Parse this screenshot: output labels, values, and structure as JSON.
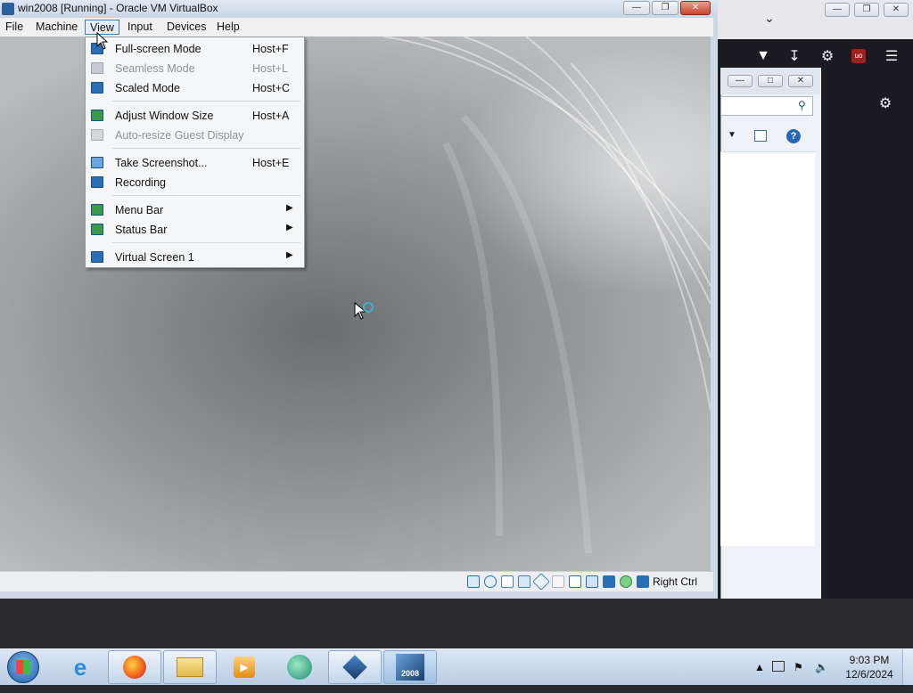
{
  "vbox": {
    "title": "win2008 [Running] - Oracle VM VirtualBox",
    "menubar": [
      "File",
      "Machine",
      "View",
      "Input",
      "Devices",
      "Help"
    ],
    "status_hostkey": "Right Ctrl"
  },
  "view_menu": {
    "items": [
      {
        "label": "Full-screen Mode",
        "shortcut": "Host+F",
        "disabled": false,
        "submenu": false
      },
      {
        "label": "Seamless Mode",
        "shortcut": "Host+L",
        "disabled": true,
        "submenu": false
      },
      {
        "label": "Scaled Mode",
        "shortcut": "Host+C",
        "disabled": false,
        "submenu": false
      },
      {
        "label": "Adjust Window Size",
        "shortcut": "Host+A",
        "disabled": false,
        "submenu": false
      },
      {
        "label": "Auto-resize Guest Display",
        "shortcut": "",
        "disabled": true,
        "submenu": false
      },
      {
        "label": "Take Screenshot...",
        "shortcut": "Host+E",
        "disabled": false,
        "submenu": false
      },
      {
        "label": "Recording",
        "shortcut": "",
        "disabled": false,
        "submenu": false
      },
      {
        "label": "Menu Bar",
        "shortcut": "",
        "disabled": false,
        "submenu": true
      },
      {
        "label": "Status Bar",
        "shortcut": "",
        "disabled": false,
        "submenu": true
      },
      {
        "label": "Virtual Screen 1",
        "shortcut": "",
        "disabled": false,
        "submenu": true
      }
    ]
  },
  "taskbar": {
    "time": "9:03 PM",
    "date": "12/6/2024",
    "vbox_badge": "2008"
  },
  "colors": {
    "accent": "#3c7fb1",
    "taskbar": "#c3d6ec",
    "vm_menu_icon": "#2a6fb5"
  }
}
